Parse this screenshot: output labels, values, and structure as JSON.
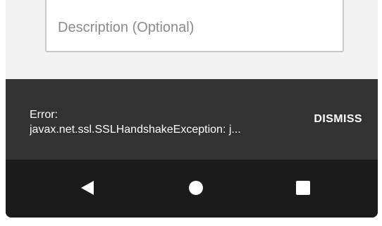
{
  "form": {
    "description_placeholder": "Description (Optional)"
  },
  "snackbar": {
    "line1": "Error:",
    "line2": "javax.net.ssl.SSLHandshakeException: j...",
    "action_label": "DISMISS"
  },
  "navbar": {
    "back_icon": "back-triangle-icon",
    "home_icon": "home-circle-icon",
    "recents_icon": "recents-square-icon"
  },
  "colors": {
    "snackbar_bg": "#323232",
    "navbar_bg": "#1b1b1b",
    "text": "#ffffff",
    "placeholder": "#8a8a8a"
  }
}
